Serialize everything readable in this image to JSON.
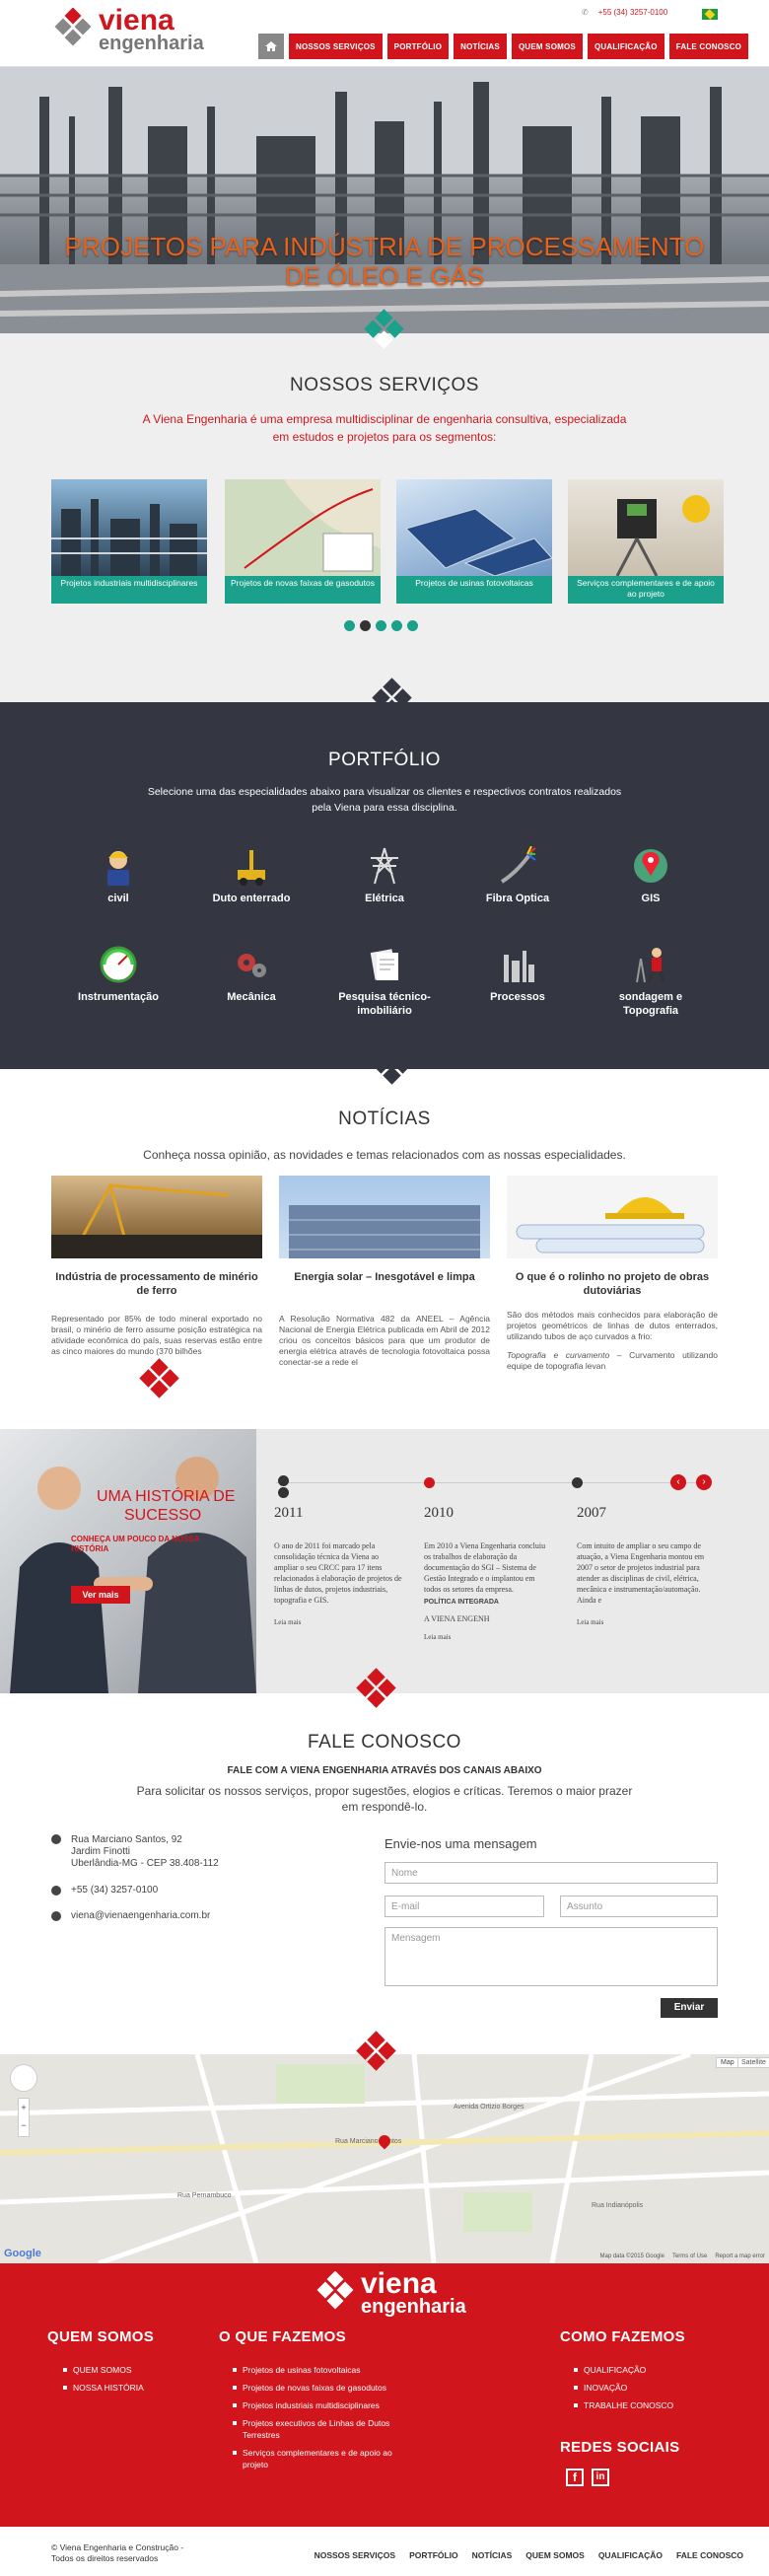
{
  "header": {
    "logo_line1": "viena",
    "logo_line2": "engenharia",
    "phone": "+55 (34) 3257-0100",
    "nav": [
      "NOSSOS SERVIÇOS",
      "PORTFÓLIO",
      "NOTÍCIAS",
      "QUEM SOMOS",
      "QUALIFICAÇÃO",
      "FALE CONOSCO"
    ]
  },
  "hero": {
    "title_line1": "PROJETOS PARA INDÚSTRIA DE PROCESSAMENTO",
    "title_line2": "DE ÓLEO E GÁS"
  },
  "services": {
    "title": "NOSSOS SERVIÇOS",
    "intro_line1": "A Viena Engenharia é uma empresa multidisciplinar de engenharia consultiva, especializada",
    "intro_line2": "em estudos e projetos para os segmentos:",
    "cards": [
      {
        "caption": "Projetos industriais multidisciplinares"
      },
      {
        "caption": "Projetos de novas faixas de gasodutos"
      },
      {
        "caption": "Projetos de usinas fotovoltaicas"
      },
      {
        "caption": "Serviços complementares e de apoio ao projeto"
      }
    ],
    "slider_active": 2
  },
  "portfolio": {
    "title": "PORTFÓLIO",
    "intro_line1": "Selecione uma das especialidades abaixo para visualizar os clientes e respectivos contratos realizados",
    "intro_line2": "pela Viena para essa disciplina.",
    "items": [
      {
        "label": "civil",
        "icon": "worker-icon"
      },
      {
        "label": "Duto enterrado",
        "icon": "drill-rig-icon"
      },
      {
        "label": "Elétrica",
        "icon": "power-tower-icon"
      },
      {
        "label": "Fibra Optica",
        "icon": "fiber-optic-icon"
      },
      {
        "label": "GIS",
        "icon": "map-pin-icon"
      },
      {
        "label": "Instrumentação",
        "icon": "gauge-icon"
      },
      {
        "label": "Mecânica",
        "icon": "gears-icon"
      },
      {
        "label": "Pesquisa técnico-imobiliário",
        "icon": "documents-icon"
      },
      {
        "label": "Processos",
        "icon": "factory-icon"
      },
      {
        "label": "sondagem e Topografia",
        "icon": "surveyor-icon"
      }
    ]
  },
  "news": {
    "title": "NOTÍCIAS",
    "intro": "Conheça nossa opinião, as novidades e temas relacionados com as nossas especialidades.",
    "items": [
      {
        "title": "Indústria de processamento de minério de ferro",
        "body": "Representado por 85% de todo mineral exportado no brasil, o minério de ferro assume posição estratégica na atividade econômica do país, suas reservas estão entre as cinco maiores do mundo (370 bilhões"
      },
      {
        "title": "Energia solar – Inesgotável e limpa",
        "body": "A Resolução Normativa 482 da ANEEL – Agência Nacional de Energia Elétrica publicada em Abril de 2012 criou os conceitos básicos para que um produtor de energia elétrica através de tecnologia fotovoltaica possa conectar-se a rede el"
      },
      {
        "title": "O que é o rolinho no projeto de obras dutoviárias",
        "body": "São dos métodos mais conhecidos para elaboração de projetos geométricos de linhas de dutos enterrados, utilizando tubos de aço curvados a frio:",
        "body2_em": "Topografia e curvamento",
        "body2": " – Curvamento utilizando equipe de topografia levan"
      }
    ]
  },
  "history": {
    "title_line1": "UMA HISTÓRIA DE",
    "title_line2": "SUCESSO",
    "subtitle_line1": "CONHEÇA UM POUCO DA NOSSA",
    "subtitle_line2": "HISTÓRIA",
    "button": "Ver mais",
    "timeline": [
      {
        "year": "2011",
        "text": "O ano de 2011 foi marcado pela consolidação técnica da Viena ao ampliar o seu CRCC para 17 itens relacionados à elaboração de projetos de linhas de dutos, projetos industriais, topografia e GIS.",
        "more": "Leia mais"
      },
      {
        "year": "2010",
        "text": "Em 2010 a Viena Engenharia concluiu os trabalhos de elaboração da documentação do SGI – Sistema de Gestão Integrado e o implantou em todos os setores da empresa.",
        "strong": "POLÍTICA INTEGRADA",
        "extra": "A VIENA ENGENH",
        "more": "Leia mais"
      },
      {
        "year": "2007",
        "text": "Com intuito de ampliar o seu campo de atuação, a Viena Engenharia montou em 2007 o setor de projetos industrial para atender as disciplinas de civil, elétrica, mecânica e instrumentação/automação. Ainda e",
        "more": "Leia mais"
      }
    ]
  },
  "contact": {
    "title": "FALE CONOSCO",
    "subtitle": "FALE COM A VIENA ENGENHARIA ATRAVÉS DOS CANAIS ABAIXO",
    "intro_line1": "Para solicitar os  nossos serviços, propor sugestões, elogios e críticas. Teremos o maior prazer",
    "intro_line2": "em respondê-lo.",
    "address_line1": "Rua Marciano Santos, 92",
    "address_line2": "Jardim Finotti",
    "address_line3": "Uberlândia-MG - CEP 38.408-112",
    "phone": "+55 (34) 3257-0100",
    "email": "viena@vienaengenharia.com.br",
    "form_title": "Envie-nos uma mensagem",
    "name_placeholder": "Nome",
    "email_placeholder": "E-mail",
    "subject_placeholder": "Assunto",
    "message_placeholder": "Mensagem",
    "send": "Enviar"
  },
  "map": {
    "map_btn": "Map",
    "sat_btn": "Satellite",
    "street1": "Rua Marciano Santos",
    "street2": "Avenida Ortizio Borges",
    "street3": "Rua Pernambuco",
    "street4": "Rua Indianópolis",
    "attribution": "Map data ©2015 Google",
    "terms": "Terms of Use",
    "report": "Report a map error",
    "google": "Google"
  },
  "footer": {
    "col1_title": "QUEM SOMOS",
    "col1": [
      "QUEM SOMOS",
      "NOSSA HISTÓRIA"
    ],
    "col2_title": "O QUE FAZEMOS",
    "col2": [
      "Projetos de usinas fotovoltaicas",
      "Projetos de novas faixas de gasodutos",
      "Projetos industriais multidisciplinares",
      "Projetos executivos de Linhas de Dutos Terrestres",
      "Serviços complementares e de apoio ao projeto"
    ],
    "col3_title": "COMO FAZEMOS",
    "col3": [
      "QUALIFICAÇÃO",
      "INOVAÇÃO",
      "TRABALHE CONOSCO"
    ],
    "social_title": "REDES SOCIAIS",
    "copyright_line1": "© Viena Engenharia e Construção -",
    "copyright_line2": "Todos os direitos reservados",
    "bottom_nav": [
      "NOSSOS SERVIÇOS",
      "PORTFÓLIO",
      "NOTÍCIAS",
      "QUEM SOMOS",
      "QUALIFICAÇÃO",
      "FALE CONOSCO"
    ]
  },
  "colors": {
    "brand_red": "#d0151c",
    "teal": "#1aa08b",
    "dark": "#343641",
    "hero_orange": "#e8611a"
  }
}
